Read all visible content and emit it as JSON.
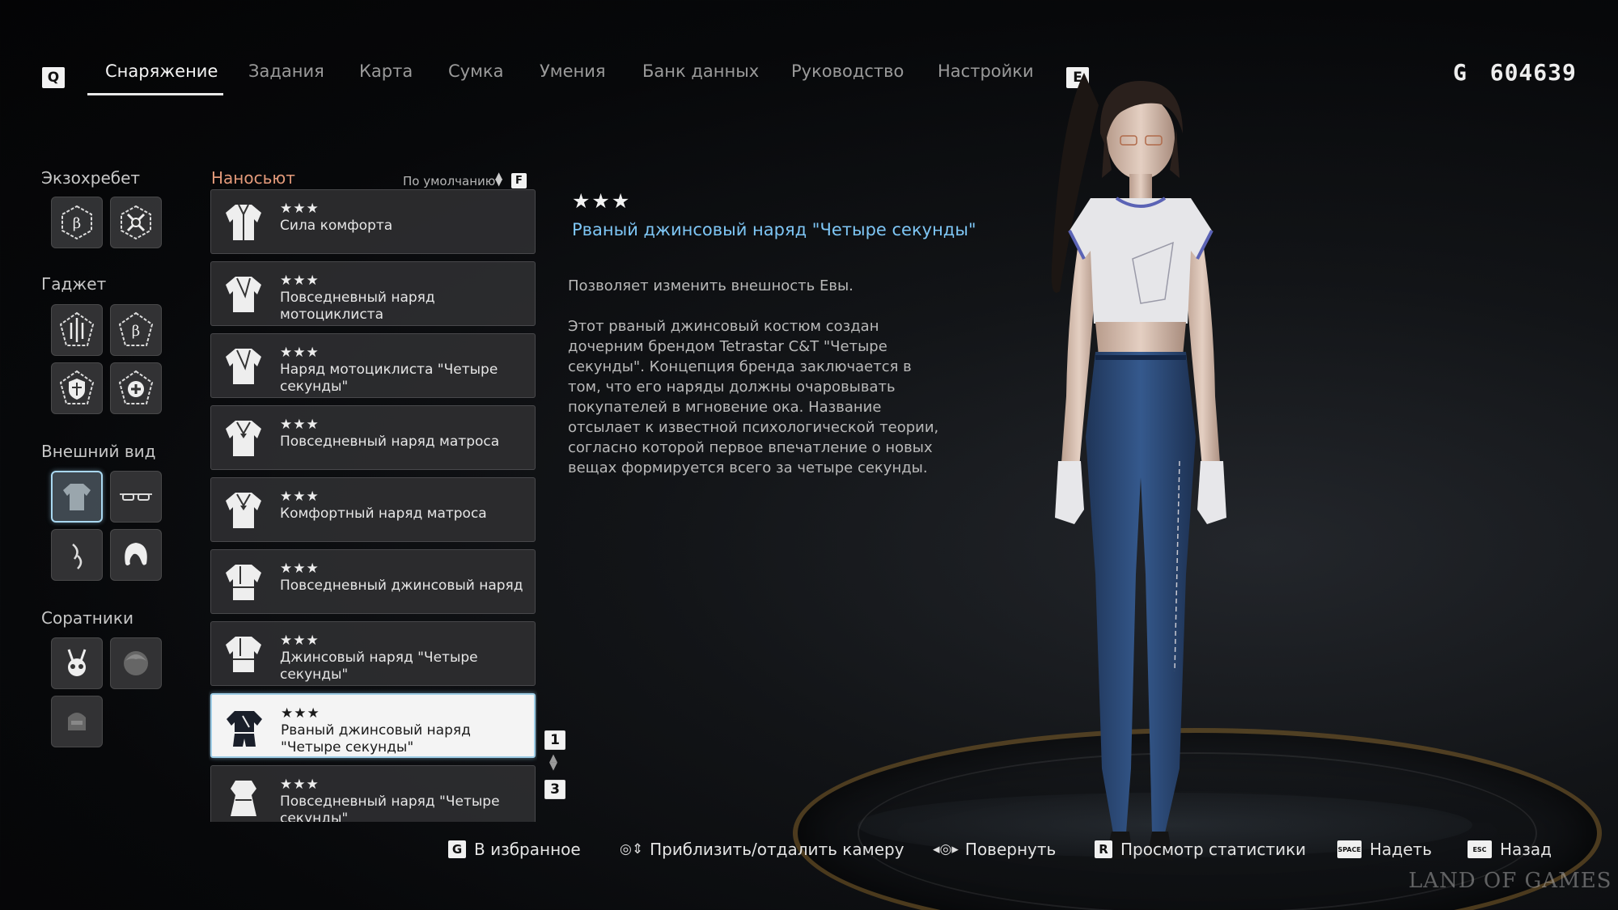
{
  "nav": {
    "key_left": "Q",
    "key_right": "E",
    "tabs": [
      {
        "label": "Снаряжение",
        "active": true
      },
      {
        "label": "Задания",
        "active": false
      },
      {
        "label": "Карта",
        "active": false
      },
      {
        "label": "Сумка",
        "active": false
      },
      {
        "label": "Умения",
        "active": false
      },
      {
        "label": "Банк данных",
        "active": false
      },
      {
        "label": "Руководство",
        "active": false
      },
      {
        "label": "Настройки",
        "active": false
      }
    ],
    "currency_symbol": "G",
    "currency_value": "604639"
  },
  "categories": {
    "exospine": "Экзохребет",
    "gadget": "Гаджет",
    "appearance": "Внешний вид",
    "companions": "Соратники"
  },
  "list": {
    "title": "Наносьют",
    "sort_label": "По умолчанию",
    "sort_key": "F",
    "items": [
      {
        "stars": "★★★",
        "name": "Сила комфорта"
      },
      {
        "stars": "★★★",
        "name": "Повседневный наряд мотоциклиста"
      },
      {
        "stars": "★★★",
        "name": "Наряд мотоциклиста \"Четыре секунды\""
      },
      {
        "stars": "★★★",
        "name": "Повседневный наряд матроса"
      },
      {
        "stars": "★★★",
        "name": "Комфортный наряд матроса"
      },
      {
        "stars": "★★★",
        "name": "Повседневный джинсовый наряд"
      },
      {
        "stars": "★★★",
        "name": "Джинсовый наряд \"Четыре секунды\""
      },
      {
        "stars": "★★★",
        "name": "Рваный джинсовый наряд \"Четыре секунды\"",
        "selected": true
      },
      {
        "stars": "★★★",
        "name": "Повседневный наряд \"Четыре секунды\""
      }
    ],
    "page_current": "1",
    "page_total": "3"
  },
  "detail": {
    "stars": "★★★",
    "title": "Рваный джинсовый наряд \"Четыре секунды\"",
    "desc_1": "Позволяет изменить внешность Евы.",
    "desc_2": "Этот рваный джинсовый костюм создан дочерним брендом Tetrastar C&T \"Четыре секунды\". Концепция бренда заключается в том, что его наряды должны очаровывать покупателей в мгновение ока. Название отсылает к известной психологической теории, согласно которой первое впечатление о новых вещах формируется всего за четыре секунды."
  },
  "hints": {
    "favorite_key": "G",
    "favorite": "В избранное",
    "zoom": "Приблизить/отдалить камеру",
    "rotate": "Повернуть",
    "stats_key": "R",
    "stats": "Просмотр статистики",
    "equip_key": "SPACE",
    "equip": "Надеть",
    "back_key": "ESC",
    "back": "Назад"
  },
  "watermark": "LAND OF GAMES",
  "colors": {
    "accent_blue": "#7ec6f5",
    "list_title": "#e39a7a",
    "selected_border": "#9ecde6"
  }
}
